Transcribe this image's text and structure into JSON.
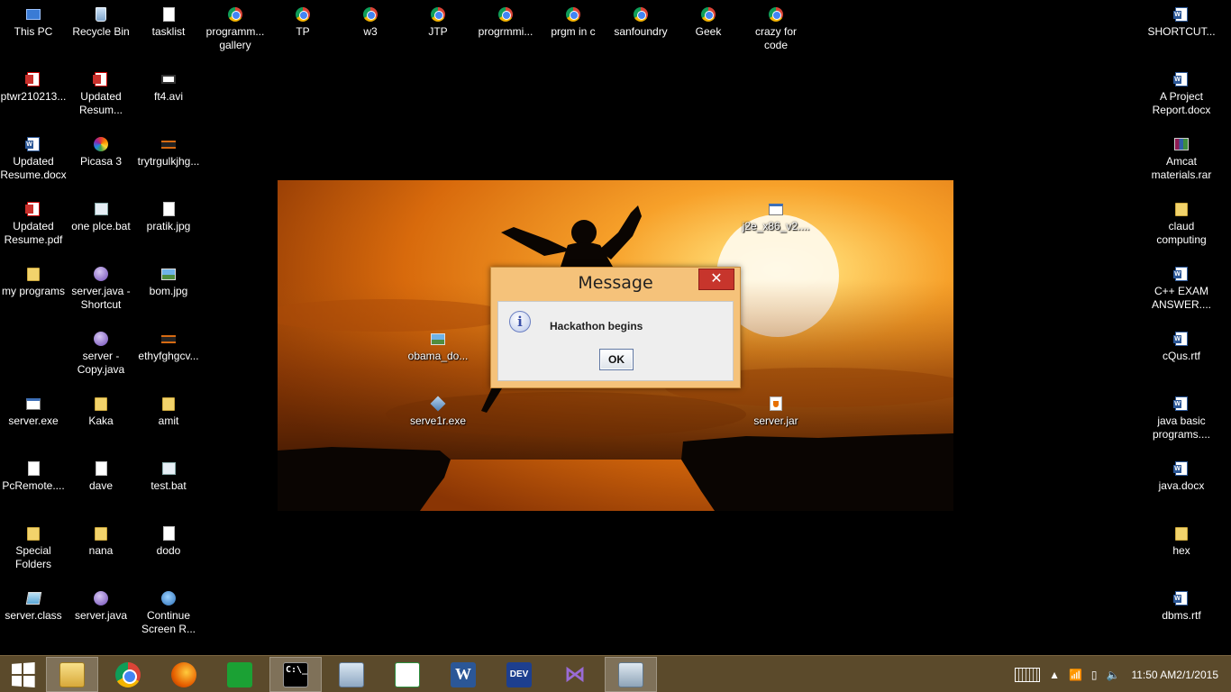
{
  "desktop": {
    "icons": [
      {
        "label": "This PC",
        "icon": "pc-icon"
      },
      {
        "label": "Recycle Bin",
        "icon": "recycle-bin-icon"
      },
      {
        "label": "tasklist",
        "icon": "file-icon"
      },
      {
        "label": "programm...\ngallery",
        "icon": "chrome-shortcut-icon"
      },
      {
        "label": "TP",
        "icon": "chrome-shortcut-icon"
      },
      {
        "label": "w3",
        "icon": "chrome-shortcut-icon"
      },
      {
        "label": "JTP",
        "icon": "chrome-shortcut-icon"
      },
      {
        "label": "progrmmi...",
        "icon": "chrome-shortcut-icon"
      },
      {
        "label": "prgm in c",
        "icon": "chrome-shortcut-icon"
      },
      {
        "label": "sanfoundry",
        "icon": "chrome-shortcut-icon"
      },
      {
        "label": "Geek",
        "icon": "chrome-shortcut-icon"
      },
      {
        "label": "crazy for\ncode",
        "icon": "chrome-shortcut-icon"
      },
      {
        "label": "SHORTCUT...",
        "icon": "word-doc-icon"
      },
      {
        "label": "ptwr210213...",
        "icon": "pdf-icon"
      },
      {
        "label": "Updated\nResum...",
        "icon": "pdf-icon"
      },
      {
        "label": "ft4.avi",
        "icon": "video-file-icon"
      },
      {
        "label": "A Project\nReport.docx",
        "icon": "word-doc-icon"
      },
      {
        "label": "Updated\nResume.docx",
        "icon": "word-doc-icon"
      },
      {
        "label": "Picasa 3",
        "icon": "picasa-icon"
      },
      {
        "label": "trytrgulkjhg...",
        "icon": "film-file-icon"
      },
      {
        "label": "Amcat\nmaterials.rar",
        "icon": "rar-archive-icon"
      },
      {
        "label": "Updated\nResume.pdf",
        "icon": "pdf-icon"
      },
      {
        "label": "one plce.bat",
        "icon": "batch-file-icon"
      },
      {
        "label": "pratik.jpg",
        "icon": "file-icon"
      },
      {
        "label": "j2e_x86_v2....",
        "icon": "installer-icon"
      },
      {
        "label": "claud\ncomputing",
        "icon": "folder-icon"
      },
      {
        "label": "my programs",
        "icon": "folder-icon"
      },
      {
        "label": "server.java -\nShortcut",
        "icon": "visual-studio-file-icon"
      },
      {
        "label": "bom.jpg",
        "icon": "image-file-icon"
      },
      {
        "label": "C++ EXAM\nANSWER....",
        "icon": "word-doc-icon"
      },
      {
        "label": "server -\nCopy.java",
        "icon": "visual-studio-file-icon"
      },
      {
        "label": "ethyfghgcv...",
        "icon": "film-file-icon"
      },
      {
        "label": "obama_do...",
        "icon": "image-file-icon"
      },
      {
        "label": "cQus.rtf",
        "icon": "word-doc-icon"
      },
      {
        "label": "server.exe",
        "icon": "exe-file-icon"
      },
      {
        "label": "Kaka",
        "icon": "folder-icon"
      },
      {
        "label": "amit",
        "icon": "folder-icon"
      },
      {
        "label": "serve1r.exe",
        "icon": "exe-gear-icon"
      },
      {
        "label": "server.jar",
        "icon": "java-jar-icon"
      },
      {
        "label": "java basic\nprograms....",
        "icon": "word-doc-icon"
      },
      {
        "label": "PcRemote....",
        "icon": "file-icon"
      },
      {
        "label": "dave",
        "icon": "file-icon"
      },
      {
        "label": "test.bat",
        "icon": "batch-file-icon"
      },
      {
        "label": "java.docx",
        "icon": "word-doc-icon"
      },
      {
        "label": "Special\nFolders",
        "icon": "folder-icon"
      },
      {
        "label": "nana",
        "icon": "folder-icon"
      },
      {
        "label": "dodo",
        "icon": "file-icon"
      },
      {
        "label": "hex",
        "icon": "folder-icon"
      },
      {
        "label": "server.class",
        "icon": "class-file-icon"
      },
      {
        "label": "server.java",
        "icon": "visual-studio-file-icon"
      },
      {
        "label": "Continue\nScreen R...",
        "icon": "network-shortcut-icon"
      },
      {
        "label": "dbms.rtf",
        "icon": "word-doc-icon"
      }
    ]
  },
  "dialog": {
    "title": "Message",
    "close_label": "✕",
    "message": "Hackathon begins",
    "ok_label": "OK",
    "info_icon_glyph": "i"
  },
  "taskbar": {
    "pinned": [
      {
        "name": "file-explorer",
        "glyph": "",
        "active": true
      },
      {
        "name": "chrome",
        "glyph": "",
        "active": false
      },
      {
        "name": "firefox",
        "glyph": "",
        "active": false
      },
      {
        "name": "store",
        "glyph": "",
        "active": false
      },
      {
        "name": "command-prompt",
        "glyph": "C:\\_",
        "active": true
      },
      {
        "name": "calculator",
        "glyph": "",
        "active": false
      },
      {
        "name": "notepad-plus-plus",
        "glyph": "",
        "active": false
      },
      {
        "name": "word",
        "glyph": "W",
        "active": false
      },
      {
        "name": "dev-cpp",
        "glyph": "DEV",
        "active": false
      },
      {
        "name": "visual-studio",
        "glyph": "",
        "active": false
      },
      {
        "name": "remote-desktop",
        "glyph": "",
        "active": true
      }
    ],
    "clock": {
      "time": "11:50 AM",
      "date": "2/1/2015"
    }
  },
  "colors": {
    "taskbar": "#5b4a2b",
    "dialog_frame": "#f5c27a",
    "dialog_close": "#c7352c",
    "desktop_bg": "#000000"
  }
}
